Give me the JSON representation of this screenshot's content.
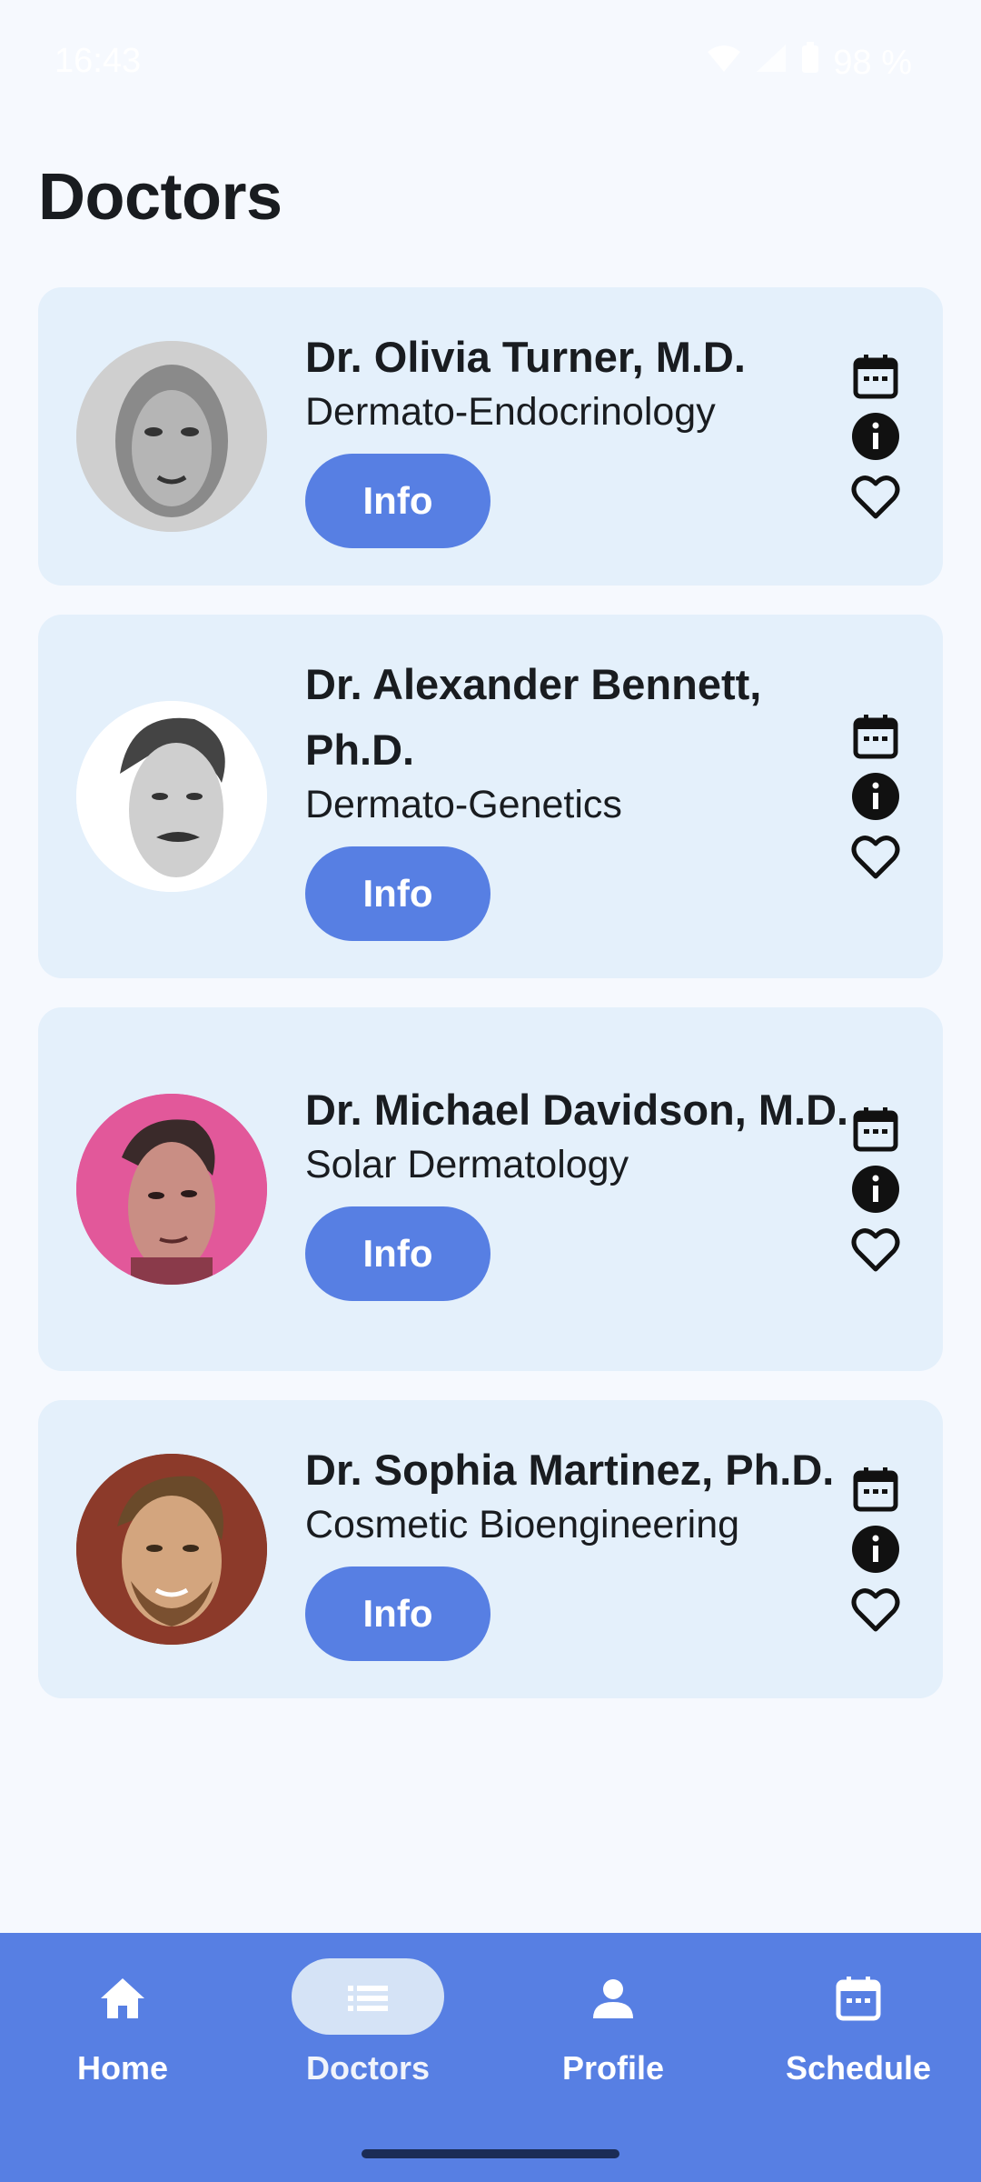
{
  "status_bar": {
    "time": "16:43",
    "battery": "98 %"
  },
  "page_title": "Doctors",
  "doctors": [
    {
      "name": "Dr. Olivia Turner, M.D.",
      "specialty": "Dermato-Endocrinology",
      "button": "Info"
    },
    {
      "name": "Dr. Alexander Bennett, Ph.D.",
      "specialty": "Dermato-Genetics",
      "button": "Info"
    },
    {
      "name": "Dr. Michael Davidson, M.D.",
      "specialty": "Solar Dermatology",
      "button": "Info"
    },
    {
      "name": "Dr. Sophia Martinez, Ph.D.",
      "specialty": "Cosmetic Bioengineering",
      "button": "Info"
    }
  ],
  "bottom_nav": [
    {
      "label": "Home",
      "icon": "home-icon"
    },
    {
      "label": "Doctors",
      "icon": "list-icon",
      "active": true
    },
    {
      "label": "Profile",
      "icon": "person-icon"
    },
    {
      "label": "Schedule",
      "icon": "calendar-icon"
    }
  ],
  "colors": {
    "accent": "#577FE3",
    "card": "#E4F0FB",
    "background": "#F6F9FE",
    "active_pill": "#D5E3F6"
  }
}
